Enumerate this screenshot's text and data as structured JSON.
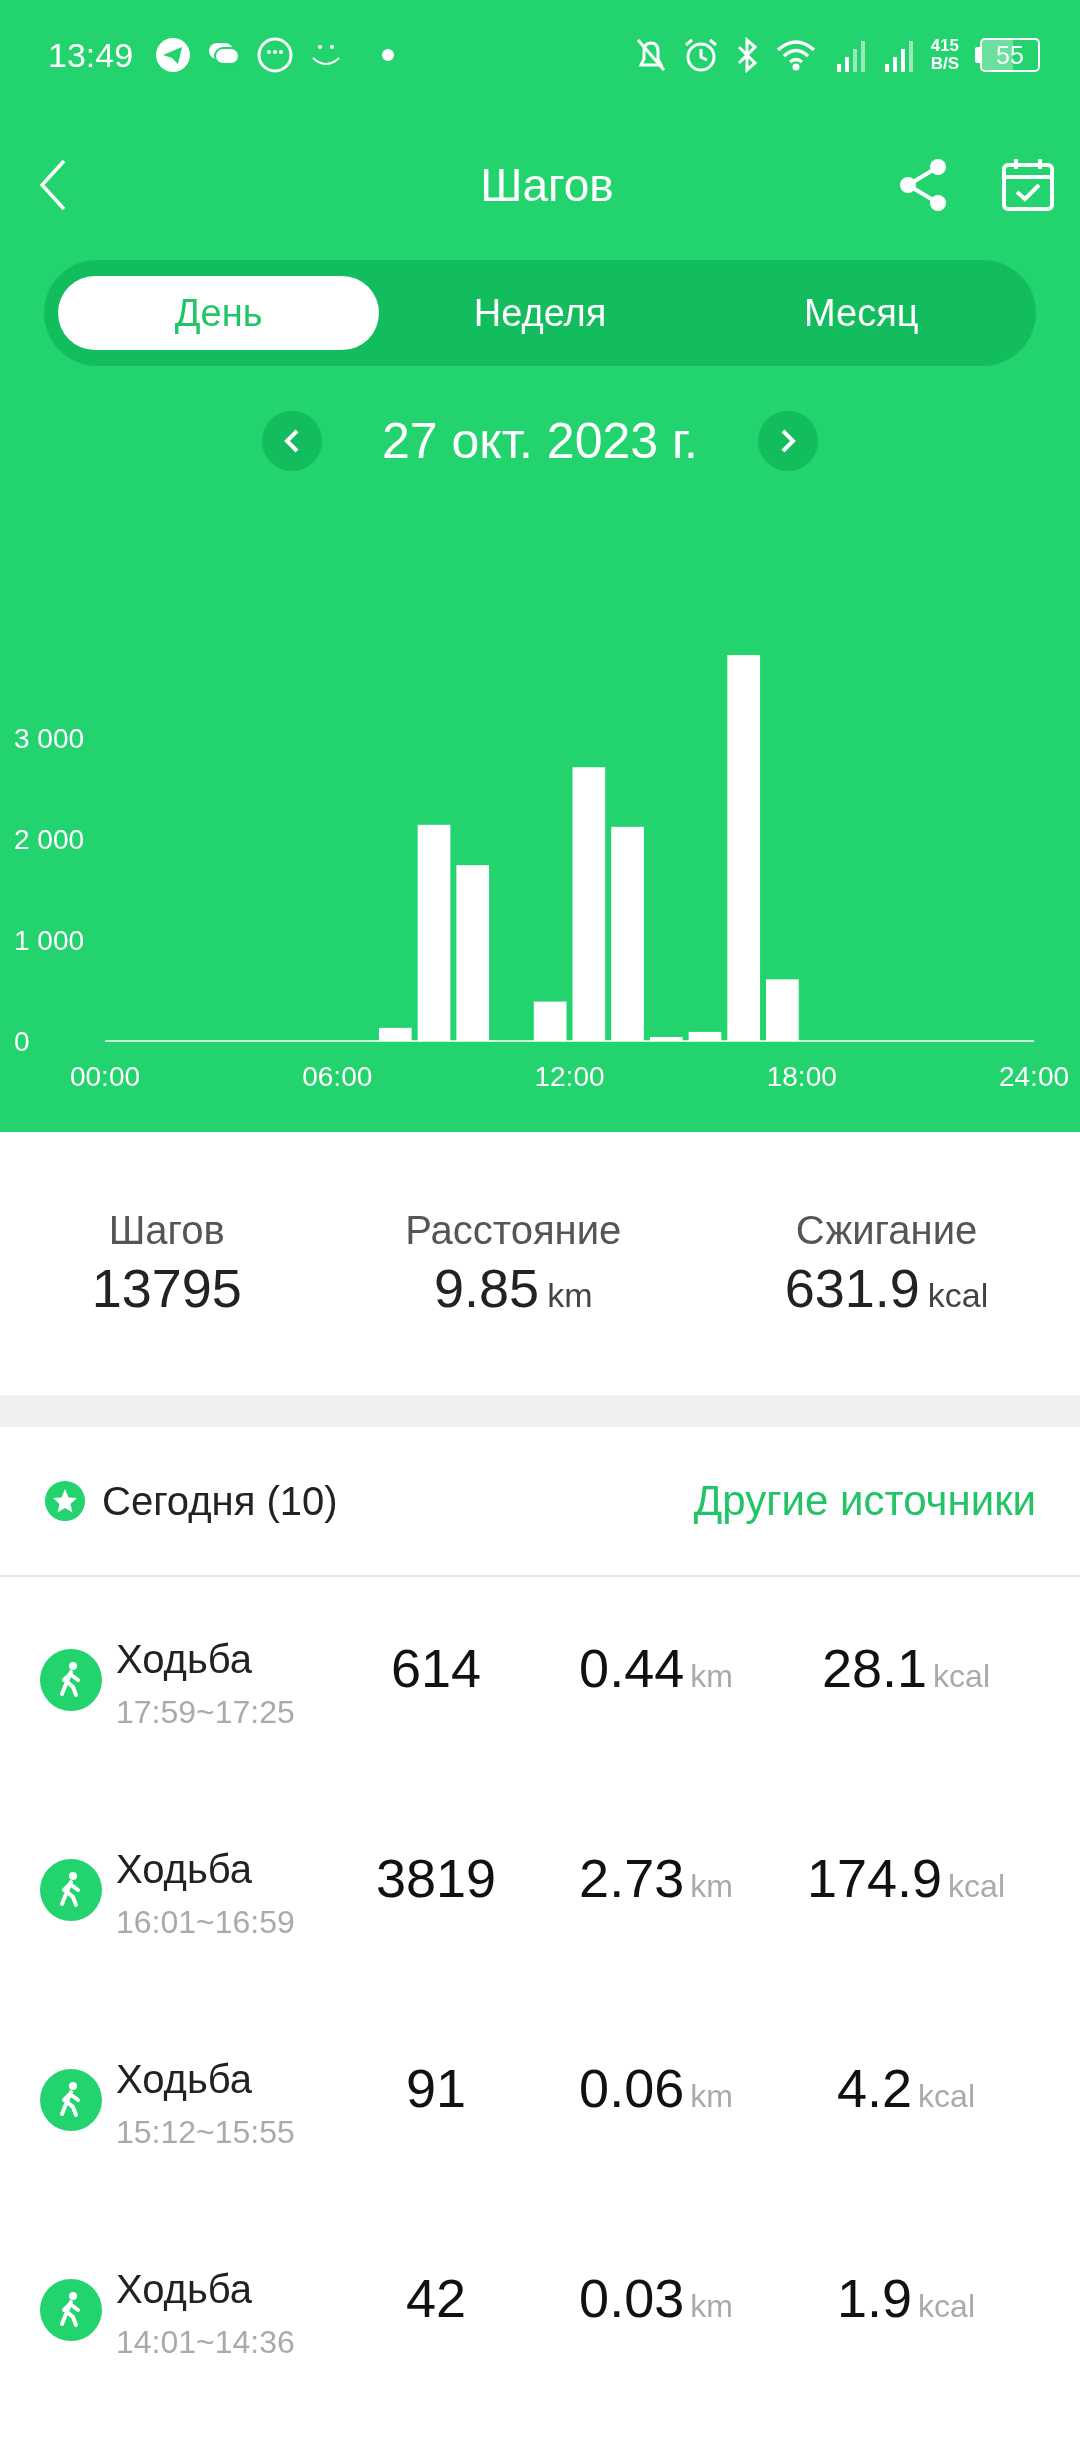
{
  "status_bar": {
    "time": "13:49",
    "net_speed": "415",
    "net_unit": "B/S",
    "battery": "55"
  },
  "header": {
    "title": "Шагов"
  },
  "tabs": [
    {
      "label": "День",
      "selected": true
    },
    {
      "label": "Неделя",
      "selected": false
    },
    {
      "label": "Месяц",
      "selected": false
    }
  ],
  "date": "27 окт. 2023 г.",
  "chart_data": {
    "type": "bar",
    "x": [
      0.5,
      1.5,
      2.5,
      3.5,
      4.5,
      5.5,
      6.5,
      7.5,
      8.5,
      9.5,
      10.5,
      11.5,
      12.5,
      13.5,
      14.5,
      15.5,
      16.5,
      17.5,
      18.5,
      19.5,
      20.5,
      21.5,
      22.5,
      23.5
    ],
    "values": [
      0,
      0,
      0,
      0,
      0,
      0,
      0,
      130,
      2140,
      1740,
      0,
      390,
      2710,
      2120,
      40,
      90,
      3820,
      610,
      0,
      0,
      0,
      0,
      0,
      0
    ],
    "xlim": [
      0,
      24
    ],
    "ylim": [
      0,
      3900
    ],
    "xticks": [
      {
        "value": 0,
        "label": "00:00"
      },
      {
        "value": 6,
        "label": "06:00"
      },
      {
        "value": 12,
        "label": "12:00"
      },
      {
        "value": 18,
        "label": "18:00"
      },
      {
        "value": 24,
        "label": "24:00"
      }
    ],
    "yticks": [
      {
        "value": 0,
        "label": "0"
      },
      {
        "value": 1000,
        "label": "1 000"
      },
      {
        "value": 2000,
        "label": "2 000"
      },
      {
        "value": 3000,
        "label": "3 000"
      }
    ]
  },
  "summary": [
    {
      "label": "Шагов",
      "value": "13795"
    },
    {
      "label": "Расстояние",
      "value": "9.85",
      "unit": "km"
    },
    {
      "label": "Сжигание",
      "value": "631.9",
      "unit": "kcal"
    }
  ],
  "section": {
    "title": "Сегодня (10)",
    "link": "Другие источники"
  },
  "records": [
    {
      "activity": "Ходьба",
      "time": "17:59~17:25",
      "steps": "614",
      "distance": "0.44",
      "distance_unit": "km",
      "calories": "28.1",
      "calories_unit": "kcal"
    },
    {
      "activity": "Ходьба",
      "time": "16:01~16:59",
      "steps": "3819",
      "distance": "2.73",
      "distance_unit": "km",
      "calories": "174.9",
      "calories_unit": "kcal"
    },
    {
      "activity": "Ходьба",
      "time": "15:12~15:55",
      "steps": "91",
      "distance": "0.06",
      "distance_unit": "km",
      "calories": "4.2",
      "calories_unit": "kcal"
    },
    {
      "activity": "Ходьба",
      "time": "14:01~14:36",
      "steps": "42",
      "distance": "0.03",
      "distance_unit": "km",
      "calories": "1.9",
      "calories_unit": "kcal"
    }
  ]
}
